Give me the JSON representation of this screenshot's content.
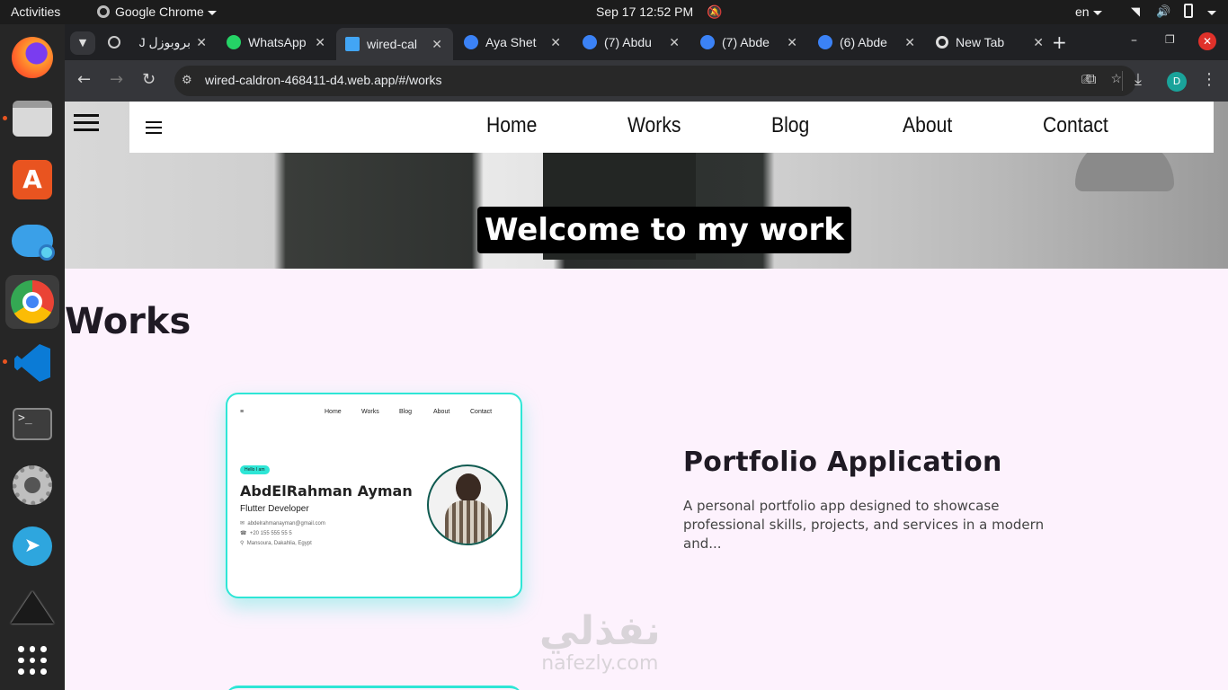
{
  "topbar": {
    "activities": "Activities",
    "app": "Google Chrome",
    "datetime": "Sep 17  12:52 PM",
    "lang": "en"
  },
  "dock": {
    "items": [
      "firefox-icon",
      "files-icon",
      "app-center-icon",
      "cloud-drive-icon",
      "chrome-icon",
      "vscode-icon",
      "terminal-icon",
      "settings-icon",
      "telegram-icon",
      "inkscape-icon",
      "app-grid-icon"
    ]
  },
  "tabs": [
    {
      "label": "بروبوزل J",
      "color": "#e8eaed"
    },
    {
      "label": "WhatsApp",
      "color": "#25d366"
    },
    {
      "label": "wired-cal",
      "color": "#42a5f5"
    },
    {
      "label": "Aya Shet",
      "color": "#3b82f6"
    },
    {
      "label": "(7) Abdu",
      "color": "#3b82f6"
    },
    {
      "label": "(7) Abde",
      "color": "#3b82f6"
    },
    {
      "label": "(6) Abde",
      "color": "#3b82f6"
    },
    {
      "label": "New Tab",
      "color": "#e8eaed"
    }
  ],
  "toolbar": {
    "url": "wired-caldron-468411-d4.web.app/#/works",
    "avatar": "D"
  },
  "site": {
    "nav": [
      "Home",
      "Works",
      "Blog",
      "About",
      "Contact"
    ],
    "welcome": "Welcome to my work",
    "works_title": "Works",
    "project": {
      "title": "Portfolio Application",
      "description": "A personal portfolio app designed to showcase professional skills, projects, and services in a modern and..."
    },
    "preview": {
      "nav": [
        "Home",
        "Works",
        "Blog",
        "About",
        "Contact"
      ],
      "badge": "Hello I am",
      "name": "AbdElRahman Ayman",
      "role": "Flutter Developer",
      "email": "abdelrahmanayman@gmail.com",
      "phone": "+20 155 555 55 5",
      "location": "Mansoura, Dakahlia, Egypt"
    },
    "watermark_ar": "نفذلي",
    "watermark_lat": "nafezly.com"
  }
}
